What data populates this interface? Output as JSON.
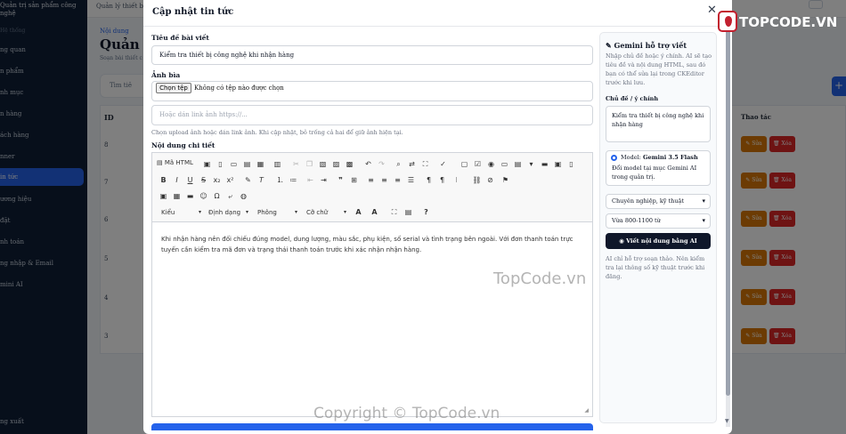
{
  "sidebar": {
    "brand": "Quản trị sản phẩm công nghệ",
    "section": "Hệ thống",
    "items": [
      "ng quan",
      "n phẩm",
      "nh mục",
      "n hàng",
      "ách hàng",
      "nner",
      "in tức",
      "ương hiệu",
      "đặt",
      "nh toán",
      "ng nhập & Email",
      "mini AI"
    ],
    "active_index": 6,
    "footer": "ng xuất"
  },
  "topbar": {
    "crumb": "Quản lý thiết bị, s"
  },
  "background": {
    "crumb": "Nội dung",
    "title": "Quản lý",
    "subtitle": "Soạn bài thiết c",
    "search_placeholder": "Tìm tiê",
    "add_button": "+",
    "table_id_header": "ID",
    "row_ids": [
      "8",
      "7",
      "6",
      "5",
      "4",
      "3"
    ],
    "actions_header": "Thao tác",
    "edit_label": "Sửa",
    "delete_label": "Xóa"
  },
  "modal": {
    "title": "Cập nhật tin tức",
    "close": "✕",
    "title_label": "Tiêu đề bài viết",
    "title_value": "Kiểm tra thiết bị công nghệ khi nhận hàng",
    "cover_label": "Ảnh bìa",
    "file_button": "Chọn tệp",
    "file_status": "Không có tệp nào được chọn",
    "url_placeholder": "Hoặc dán link ảnh https://...",
    "cover_hint": "Chọn upload ảnh hoặc dán link ảnh. Khi cập nhật, bỏ trống cả hai để giữ ảnh hiện tại.",
    "content_label": "Nội dung chi tiết"
  },
  "editor": {
    "source_label": "Mã HTML",
    "combos": [
      "Kiểu",
      "Định dạng",
      "Phông",
      "Cỡ chữ"
    ],
    "body": "Khi nhận hàng nên đối chiếu đúng model, dung lượng, màu sắc, phụ kiện, số serial và tình trạng bên ngoài. Với đơn thanh toán trực tuyến cần kiểm tra mã đơn và trạng thái thanh toán trước khi xác nhận nhận hàng."
  },
  "ai": {
    "title": "Gemini hỗ trợ viết",
    "description": "Nhập chủ đề hoặc ý chính. AI sẽ tạo tiêu đề và nội dung HTML, sau đó bạn có thể sửa lại trong CKEditor trước khi lưu.",
    "topic_label": "Chủ đề / ý chính",
    "topic_value": "Kiểm tra thiết bị công nghệ khi nhận hàng",
    "model_prefix": "Model:",
    "model_name": "Gemini 3.5 Flash",
    "model_note": "Đổi model tại mục Gemini AI trong quản trị.",
    "tone": "Chuyên nghiệp, kỹ thuật",
    "length": "Vừa 800-1100 từ",
    "generate_button": "Viết nội dung bằng AI",
    "note": "AI chỉ hỗ trợ soạn thảo. Nên kiểm tra lại thông số kỹ thuật trước khi đăng."
  },
  "branding": {
    "logo_text": "TOPCODE.VN",
    "watermark_center": "TopCode.vn",
    "watermark_bottom": "Copyright © TopCode.vn"
  }
}
